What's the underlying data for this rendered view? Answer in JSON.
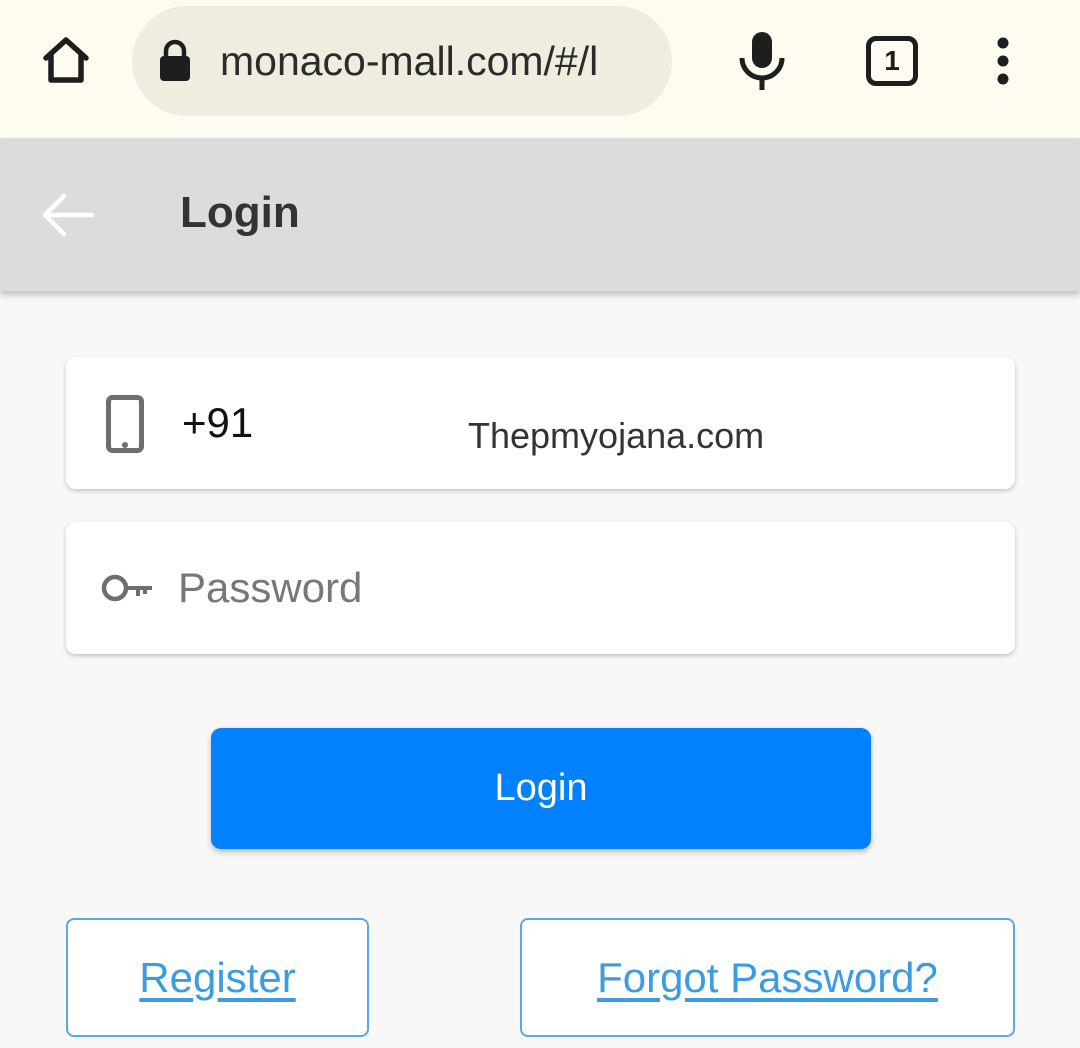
{
  "browser": {
    "url": "monaco-mall.com/#/l",
    "tab_count": "1",
    "icons": [
      "home-icon",
      "lock-icon",
      "mic-icon",
      "tabs-icon",
      "more-vert-icon"
    ]
  },
  "header": {
    "title": "Login",
    "back_icon": "arrow-left-icon"
  },
  "form": {
    "phone": {
      "icon": "smartphone-icon",
      "country_code": "+91",
      "value": "Thepmyojana.com"
    },
    "password": {
      "icon": "key-icon",
      "placeholder": "Password",
      "value": ""
    },
    "login_label": "Login"
  },
  "links": {
    "register": "Register",
    "forgot_password": "Forgot Password?"
  },
  "colors": {
    "browser_bar": "#fefbf0",
    "url_pill": "#efedde",
    "header_bg": "#dcdcdc",
    "primary": "#0281ff",
    "link": "#3d9be0",
    "page_bg": "#f8f8f8"
  }
}
